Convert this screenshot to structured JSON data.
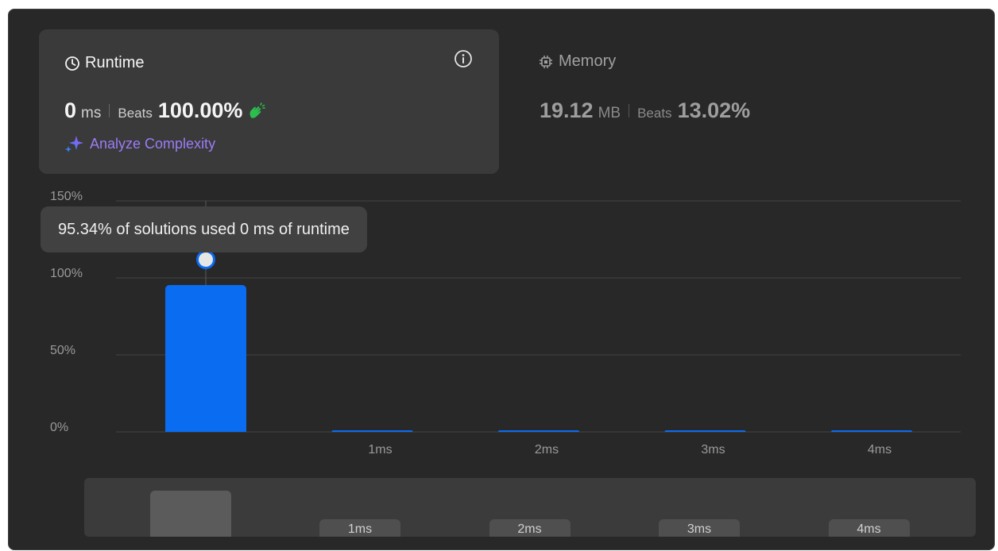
{
  "runtime": {
    "title": "Runtime",
    "value": "0",
    "unit": "ms",
    "beats_label": "Beats",
    "beats_value": "100.00%",
    "analyze_label": "Analyze Complexity"
  },
  "memory": {
    "title": "Memory",
    "value": "19.12",
    "unit": "MB",
    "beats_label": "Beats",
    "beats_value": "13.02%"
  },
  "tooltip": "95.34% of solutions used 0 ms of runtime",
  "chart_data": {
    "type": "bar",
    "categories": [
      "0ms",
      "1ms",
      "2ms",
      "3ms",
      "4ms"
    ],
    "x_tick_labels": [
      "",
      "1ms",
      "2ms",
      "3ms",
      "4ms"
    ],
    "values": [
      95.34,
      1,
      1,
      1,
      1
    ],
    "y_ticks": [
      "0%",
      "50%",
      "100%",
      "150%"
    ],
    "ylim": [
      0,
      150
    ],
    "grid": true,
    "highlighted_index": 0,
    "bar_color": "#0a6cf0"
  },
  "minimap": {
    "labels": [
      "1ms",
      "2ms",
      "3ms",
      "4ms"
    ]
  },
  "colors": {
    "panel_bg": "#282828",
    "card_bg": "#3a3a3a",
    "accent_blue": "#0a6cf0",
    "analyze_purple": "#9b7cf5",
    "clap_green": "#2bbf4e"
  }
}
